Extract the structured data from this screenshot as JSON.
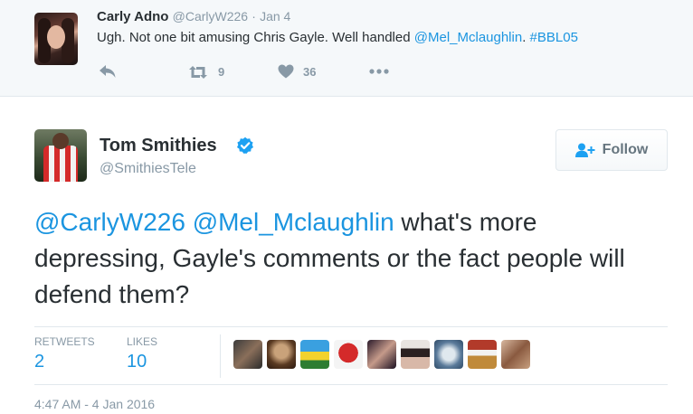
{
  "parent_tweet": {
    "name": "Carly Adno",
    "handle": "@CarlyW226",
    "separator": "·",
    "time": "Jan 4",
    "text_plain": "Ugh. Not one bit amusing Chris Gayle. Well handled ",
    "text_mention": "@Mel_Mclaughlin",
    "text_hashtag": "#BBL05",
    "retweet_count": "9",
    "like_count": "36",
    "icons": [
      "reply-icon",
      "retweet-icon",
      "heart-icon",
      "more-icon"
    ]
  },
  "main_tweet": {
    "name": "Tom Smithies",
    "handle": "@SmithiesTele",
    "follow_label": "Follow",
    "mention_1": "@CarlyW226",
    "mention_2": "@Mel_Mclaughlin",
    "body": " what's more depressing, Gayle's comments or the fact people will defend them?",
    "retweets_label": "RETWEETS",
    "retweets_value": "2",
    "likes_label": "LIKES",
    "likes_value": "10",
    "timestamp": "4:47 AM - 4 Jan 2016"
  },
  "colors": {
    "link": "#1b95e0",
    "muted": "#8899a6",
    "text": "#292f33",
    "border": "#e1e8ed",
    "parent_bg": "#f5f8fa"
  }
}
